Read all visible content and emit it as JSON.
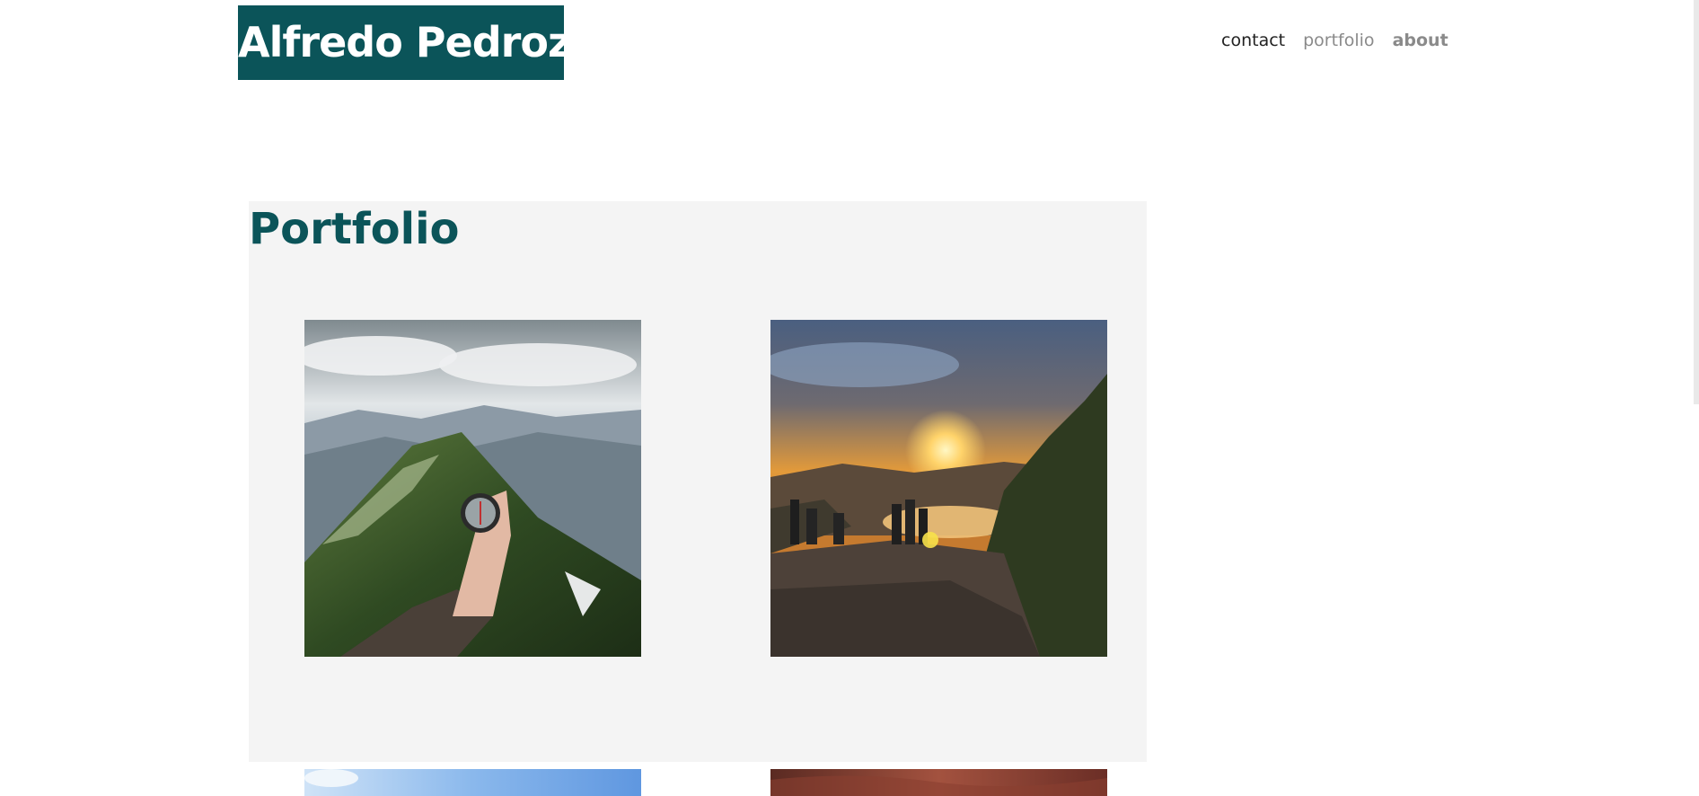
{
  "header": {
    "logo_text": "Alfredo Pedroza",
    "nav": {
      "contact": "contact",
      "portfolio": "portfolio",
      "about": "about"
    }
  },
  "portfolio": {
    "title": "Portfolio"
  },
  "colors": {
    "brand": "#0b5459",
    "section_bg": "#f4f4f4",
    "nav_active": "#222222",
    "nav_muted": "#8a8a8a"
  }
}
